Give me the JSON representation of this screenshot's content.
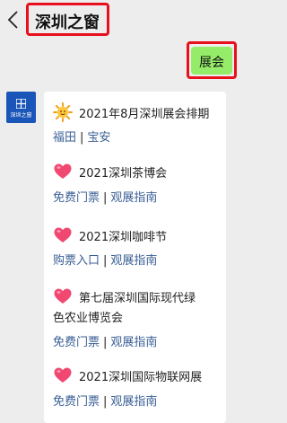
{
  "header": {
    "title": "深圳之窗"
  },
  "user_message": {
    "text": "展会"
  },
  "bot": {
    "avatar_text": "深圳之窗",
    "events": [
      {
        "icon": "sun-emoji-icon",
        "title": "2021年8月深圳展会排期",
        "links": [
          "福田",
          "宝安"
        ]
      },
      {
        "icon": "heart-emoji-icon",
        "title": "2021深圳茶博会",
        "links": [
          "免费门票",
          "观展指南"
        ]
      },
      {
        "icon": "heart-emoji-icon",
        "title": "2021深圳咖啡节",
        "links": [
          "购票入口",
          "观展指南"
        ]
      },
      {
        "icon": "heart-emoji-icon",
        "title_line1": "第七届深圳国际现代绿",
        "title_line2": "色农业博览会",
        "links": [
          "免费门票",
          "观展指南"
        ]
      },
      {
        "icon": "heart-emoji-icon",
        "title": "2021深圳国际物联网展",
        "links": [
          "免费门票",
          "观展指南"
        ]
      }
    ]
  },
  "colors": {
    "background": "#ededed",
    "highlight": "#e8101c",
    "user_bubble": "#95ec69",
    "link": "#3a5f95",
    "avatar": "#1a56b8"
  }
}
